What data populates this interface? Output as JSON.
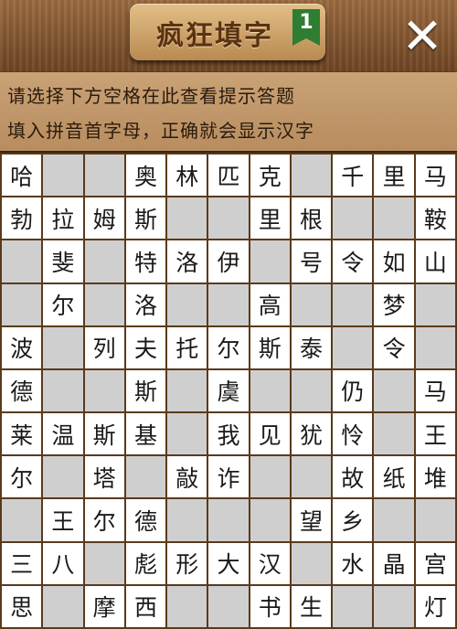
{
  "header": {
    "title": "疯狂填字",
    "level": "1",
    "close_icon": "close-icon"
  },
  "hint": {
    "line1": "请选择下方空格在此查看提示答题",
    "line2": "填入拼音首字母，正确就会显示汉字"
  },
  "colors": {
    "wood_dark": "#6e4524",
    "hint_bg": "#c9a276",
    "cell_white": "#ffffff",
    "cell_gray": "#cfcfcf",
    "badge_green": "#2e7d32"
  },
  "grid": {
    "rows": [
      [
        "哈",
        null,
        null,
        "奥",
        "林",
        "匹",
        "克",
        null,
        "千",
        "里",
        "马"
      ],
      [
        "勃",
        "拉",
        "姆",
        "斯",
        null,
        null,
        "里",
        "根",
        null,
        null,
        "鞍"
      ],
      [
        null,
        "斐",
        null,
        "特",
        "洛",
        "伊",
        null,
        "号",
        "令",
        "如",
        "山"
      ],
      [
        null,
        "尔",
        null,
        "洛",
        null,
        null,
        "高",
        null,
        null,
        "梦",
        null
      ],
      [
        "波",
        null,
        "列",
        "夫",
        "托",
        "尔",
        "斯",
        "泰",
        null,
        "令",
        null
      ],
      [
        "德",
        null,
        null,
        "斯",
        null,
        "虞",
        null,
        null,
        "仍",
        null,
        "马"
      ],
      [
        "莱",
        "温",
        "斯",
        "基",
        null,
        "我",
        "见",
        "犹",
        "怜",
        null,
        "王"
      ],
      [
        "尔",
        null,
        "塔",
        null,
        "敲",
        "诈",
        null,
        null,
        "故",
        "纸",
        "堆"
      ],
      [
        null,
        "王",
        "尔",
        "德",
        null,
        null,
        null,
        "望",
        "乡",
        null,
        null
      ],
      [
        "三",
        "八",
        null,
        "彪",
        "形",
        "大",
        "汉",
        null,
        "水",
        "晶",
        "宫"
      ],
      [
        "思",
        null,
        "摩",
        "西",
        null,
        null,
        "书",
        "生",
        null,
        null,
        "灯"
      ]
    ]
  }
}
